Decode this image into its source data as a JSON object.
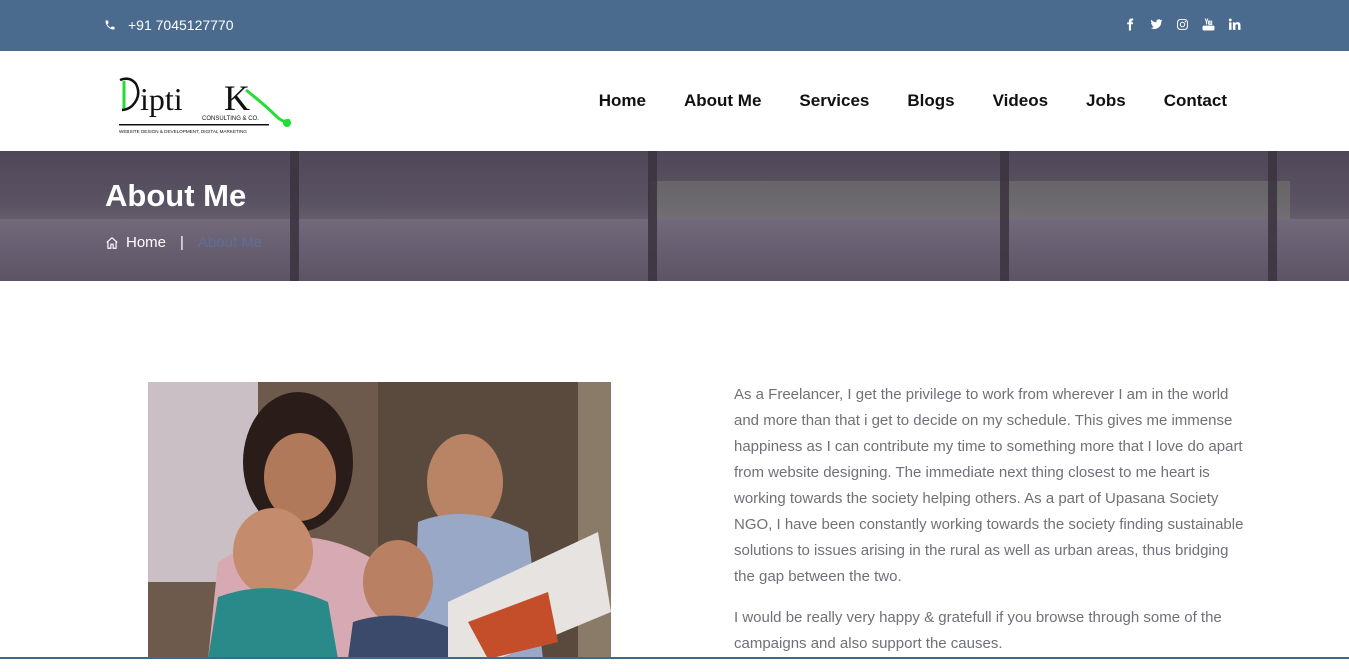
{
  "topbar": {
    "phone": "+91 7045127770",
    "social_icons": [
      "facebook-icon",
      "twitter-icon",
      "instagram-icon",
      "youtube-icon",
      "linkedin-icon"
    ]
  },
  "logo": {
    "main": "DiptiK",
    "sub": "CONSULTING & CO.",
    "tagline": "WEBSITE DESIGN & DEVELOPMENT, DIGITAL MARKETING"
  },
  "nav": {
    "items": [
      "Home",
      "About Me",
      "Services",
      "Blogs",
      "Videos",
      "Jobs",
      "Contact"
    ]
  },
  "banner": {
    "title": "About Me",
    "breadcrumb_home": "Home",
    "breadcrumb_sep": "|",
    "breadcrumb_current": "About Me"
  },
  "content": {
    "paragraph1": "As a Freelancer, I get the privilege to work from wherever I am in the world and more than that i get to decide on my schedule. This gives me immense happiness as I can contribute my time to something more that I love do apart from website designing. The immediate next thing closest to me heart is working towards the society helping others. As a part of Upasana Society NGO, I have been constantly working towards the society finding sustainable solutions to issues arising in the rural as well as urban areas, thus bridging the gap between the two.",
    "paragraph2": "I would be really very happy & gratefull if you browse through some of the campaigns and also support the causes."
  },
  "colors": {
    "topbar": "#4a6a8e",
    "logo_green": "#22dd33",
    "breadcrumb_current": "#5e6f95",
    "body_text": "#707078"
  }
}
